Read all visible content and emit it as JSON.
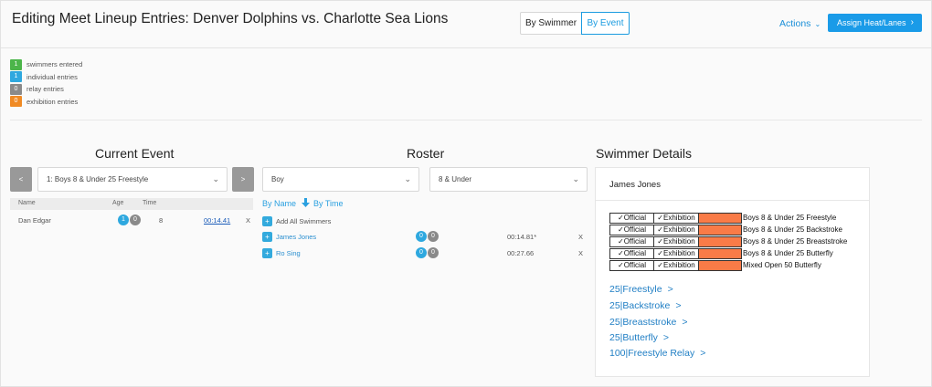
{
  "header": {
    "title": "Editing Meet Lineup Entries: Denver Dolphins vs. Charlotte Sea Lions",
    "view_by_swimmer": "By Swimmer",
    "view_by_event": "By Event",
    "actions_label": "Actions",
    "actions_chevron": "⌄",
    "assign_label": "Assign Heat/Lanes",
    "assign_arrow": "›"
  },
  "legend": [
    {
      "count": "1",
      "label": "swimmers entered",
      "color": "#4cb54a"
    },
    {
      "count": "1",
      "label": "individual entries",
      "color": "#2ea8df"
    },
    {
      "count": "0",
      "label": "relay entries",
      "color": "#8a8a8a"
    },
    {
      "count": "0",
      "label": "exhibition entries",
      "color": "#f08a24"
    }
  ],
  "current_event": {
    "title": "Current Event",
    "prev": "<",
    "next": ">",
    "selected_event": "1: Boys 8 & Under 25 Freestyle",
    "columns": {
      "name": "Name",
      "age": "Age",
      "time": "Time"
    },
    "rows": [
      {
        "name": "Dan Edgar",
        "badge1": "1",
        "badge2": "0",
        "age": "8",
        "time": "00:14.41",
        "remove": "X"
      }
    ]
  },
  "roster": {
    "title": "Roster",
    "gender_filter": "Boy",
    "age_filter": "8 & Under",
    "sort_by_name": "By Name",
    "sort_by_time": "By Time",
    "add_all": "Add All Swimmers",
    "add_symbol": "+",
    "swimmers": [
      {
        "name": "James Jones",
        "badge1": "0",
        "badge2": "0",
        "time": "00:14.81*",
        "remove": "X"
      },
      {
        "name": "Ro Sing",
        "badge1": "0",
        "badge2": "0",
        "time": "00:27.66",
        "remove": "X"
      }
    ]
  },
  "swimmer_details": {
    "title": "Swimmer Details",
    "name": "James Jones",
    "official_label": "✓Official",
    "exhibition_label": "✓Exhibition",
    "entries": [
      {
        "event": "Boys  8 & Under 25 Freestyle"
      },
      {
        "event": "Boys  8 & Under 25 Backstroke"
      },
      {
        "event": "Boys  8 & Under 25 Breaststroke"
      },
      {
        "event": "Boys  8 & Under 25 Butterfly"
      },
      {
        "event": "Mixed  Open 50 Butterfly"
      }
    ],
    "event_links": [
      "25|Freestyle",
      "25|Backstroke",
      "25|Breaststroke",
      "25|Butterfly",
      "100|Freestyle Relay"
    ],
    "link_arrow": ">"
  },
  "colors": {
    "accent": "#1a9be8",
    "badge_blue": "#2ea8df",
    "badge_gray": "#8a8a8a",
    "highlight_orange": "#f97b47"
  }
}
